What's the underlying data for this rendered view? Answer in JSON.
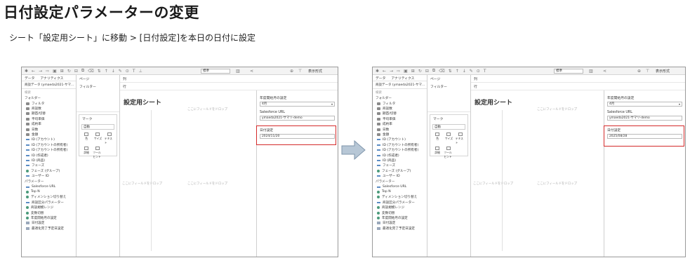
{
  "title": "日付設定パラメーターの変更",
  "subtitle": "シート「設定用シート」に移動 > [日付設定]を本日の日付に設定",
  "colors": {
    "highlight": "#d42a2a",
    "arrow": "#b7c7d6",
    "arrow_border": "#7f95ab"
  },
  "screens": [
    {
      "toolbar": {
        "standard": "標準",
        "display": "表示形式"
      },
      "tabs": [
        "データ",
        "アナリティクス"
      ],
      "source": "商談データ (ymaeda2021-サマ...",
      "search_placeholder": "検索",
      "folders_label": "フォルダー",
      "folders": [
        "フィルタ",
        "商談数",
        "期首/切替",
        "平均単価",
        "成約率",
        "日数",
        "金額"
      ],
      "fields": [
        "ID (アカウント)",
        "ID (アカウントの所有者)",
        "ID (アカウントの所有者)",
        "ID (作成者)",
        "ID (商品)",
        "フェーズ",
        "フェーズ (グループ)",
        "ユーザー ID"
      ],
      "params_label": "パラメーター",
      "params": [
        "Salesforce URL",
        "Top N",
        "ディメンション切り替え",
        "商談区分パラメーター",
        "商談規模レンジ",
        "変数切替",
        "年度開始月の設定",
        "日付設定",
        "最適化完了予定日設定"
      ],
      "pages_label": "ページ",
      "filters_label": "フィルター",
      "marks_label": "マーク",
      "marks_auto": "自動",
      "marks": [
        "色",
        "サイズ",
        "テキスト",
        "詳細",
        "ツールヒント"
      ],
      "columns_label": "列",
      "rows_label": "行",
      "sheet_title": "設定用シート",
      "drop_field": "ここにフィールドをドロップ",
      "param_cards": {
        "fiscal_title": "年度開始月の設定",
        "fiscal_value": "4月",
        "url_title": "Salesforce URL",
        "url_value": "ymaeda2021-サマリ-demo",
        "date_title": "日付設定",
        "date_value": "2024/11/20"
      }
    },
    {
      "toolbar": {
        "standard": "標準",
        "display": "表示形式"
      },
      "tabs": [
        "データ",
        "アナリティクス"
      ],
      "source": "商談データ (ymaeda2021-サマ...",
      "search_placeholder": "検索",
      "folders_label": "フォルダー",
      "folders": [
        "フィルタ",
        "商談数",
        "期首/切替",
        "平均単価",
        "成約率",
        "日数",
        "金額"
      ],
      "fields": [
        "ID (アカウント)",
        "ID (アカウントの所有者)",
        "ID (アカウントの所有者)",
        "ID (作成者)",
        "ID (商品)",
        "フェーズ",
        "フェーズ (グループ)",
        "ユーザー ID"
      ],
      "params_label": "パラメーター",
      "params": [
        "Salesforce URL",
        "Top N",
        "ディメンション切り替え",
        "商談区分パラメーター",
        "商談規模レンジ",
        "変数切替",
        "年度開始月の設定",
        "日付設定",
        "最適化完了予定日設定"
      ],
      "pages_label": "ページ",
      "filters_label": "フィルター",
      "marks_label": "マーク",
      "marks_auto": "自動",
      "marks": [
        "色",
        "サイズ",
        "テキスト",
        "詳細",
        "ツールヒント"
      ],
      "columns_label": "列",
      "rows_label": "行",
      "sheet_title": "設定用シート",
      "drop_field": "ここにフィールドをドロップ",
      "param_cards": {
        "fiscal_title": "年度開始月の設定",
        "fiscal_value": "4月",
        "url_title": "Salesforce URL",
        "url_value": "ymaeda2021-サマリ-demo",
        "date_title": "日付設定",
        "date_value": "2025/08/28"
      }
    }
  ]
}
